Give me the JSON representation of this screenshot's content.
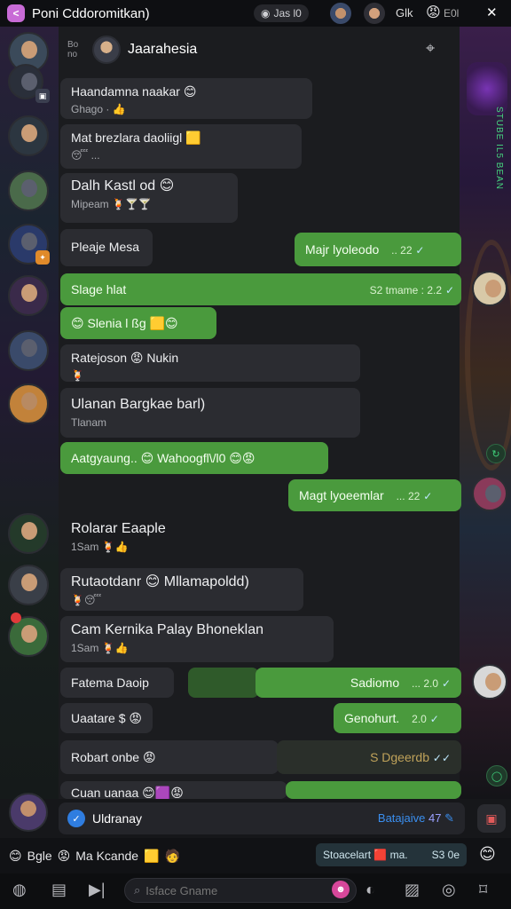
{
  "topbar": {
    "title": "Poni Cddoromitkan)",
    "pill": "Jas l0",
    "gk": "Glk",
    "count": "E0l",
    "close": "✕"
  },
  "chat_header": {
    "small_top": "Bo",
    "small_bottom": "no",
    "name": "Jaarahesia"
  },
  "messages": [
    {
      "dir": "in",
      "text": "Haandamna naakar 😊",
      "sub": "Ghago · 👍"
    },
    {
      "dir": "in",
      "text": "Mat brezlara daoliigl 🟨",
      "sub": "😴 ..."
    },
    {
      "dir": "in",
      "text": "Dalh Kastl od 😊",
      "sub": "Mipeam 🍹🍸🍸"
    },
    {
      "dir": "in",
      "text": "Pleaje Mesa"
    },
    {
      "dir": "out",
      "text": "Majr lyoleodo",
      "time": "22"
    },
    {
      "dir": "out",
      "text": "Slage hlat",
      "time": "S2 tmame : 2.2"
    },
    {
      "dir": "out",
      "text": "😊 Slenia  l ßg 🟨😊"
    },
    {
      "dir": "in",
      "text": "Ratejoson 😡 Nukin",
      "sub": "🍹"
    },
    {
      "dir": "in",
      "text": "Ulanan Bargkae barl)",
      "sub": "Tlanam"
    },
    {
      "dir": "out",
      "text": "Aatgyaung.. 😊 Wahoogfl\\/l0 😊😡"
    },
    {
      "dir": "out",
      "text": "Magt lyoeemlar",
      "time": "22"
    },
    {
      "dir": "in",
      "text": "Rolarar Eaaple",
      "sub": "1Sam 🍹👍"
    },
    {
      "dir": "in",
      "text": "Rutaotdanr 😊 Mllamapoldd)",
      "sub": "🍹😴"
    },
    {
      "dir": "in",
      "text": "Cam Kernika Palay Bhoneklan",
      "sub": "1Sam 🍹👍"
    },
    {
      "dir": "in",
      "text": "Fatema Daoip"
    },
    {
      "dir": "out",
      "text": "Sadiomo",
      "time": "2.0"
    },
    {
      "dir": "in",
      "text": "Uaatare $ 😡"
    },
    {
      "dir": "out",
      "text": "Genohurt.",
      "time": "2.0"
    },
    {
      "dir": "in",
      "text": "Robart onbe 😡"
    },
    {
      "dir": "out",
      "text": "S Dgeerdb"
    },
    {
      "dir": "in",
      "text": "Cuan uanaa 😊🟪😡"
    }
  ],
  "right_column": {
    "vertical_text": "STUBE IL5 BEAN"
  },
  "reply": {
    "name": "Uldranay",
    "right": "Batajaive",
    "counter": "47"
  },
  "reactions": {
    "left1": "Bgle",
    "left2": "Ma Kcande",
    "chip": "Stoacelart 🟥 ma.",
    "chip_value": "S3 0e"
  },
  "bottombar": {
    "placeholder": "Isface Gname"
  },
  "colors": {
    "accent_green": "#4a9a3d",
    "incoming_bubble": "#2b2c31",
    "read_receipt": "#bfe9ff",
    "reply_link": "#3a8ff0"
  }
}
